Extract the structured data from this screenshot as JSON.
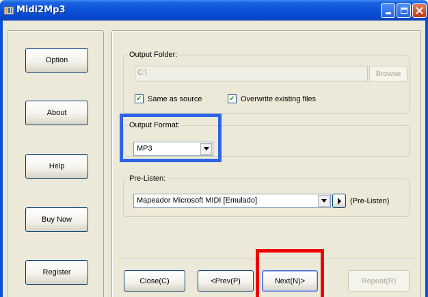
{
  "window": {
    "title": "Midi2Mp3"
  },
  "sidebar": {
    "buttons": [
      "Option",
      "About",
      "Help",
      "Buy Now",
      "Register"
    ]
  },
  "output_folder": {
    "legend": "Output Folder:",
    "path_value": "C:\\",
    "browse_label": "Browse",
    "same_as_source_label": "Same as source",
    "same_as_source_checked": true,
    "overwrite_label": "Overwrite existing files",
    "overwrite_checked": true
  },
  "output_format": {
    "legend": "Output Format:",
    "selected": "MP3"
  },
  "pre_listen": {
    "legend": "Pre-Listen:",
    "device_selected": "Mapeador Microsoft MIDI [Emulado]",
    "play_label": "(Pre-Listen)"
  },
  "footer": {
    "close_label": "Close(C)",
    "prev_label": "<Prev(P)",
    "next_label": "Next(N)>",
    "repeat_label": "Repeat(R)"
  },
  "highlights": {
    "output_format_color": "#2f63e6",
    "next_button_color": "#ee0000"
  },
  "icons": [
    "app-icon",
    "minimize-icon",
    "maximize-icon",
    "close-icon",
    "checkbox-check-icon",
    "dropdown-arrow-icon",
    "play-icon"
  ]
}
